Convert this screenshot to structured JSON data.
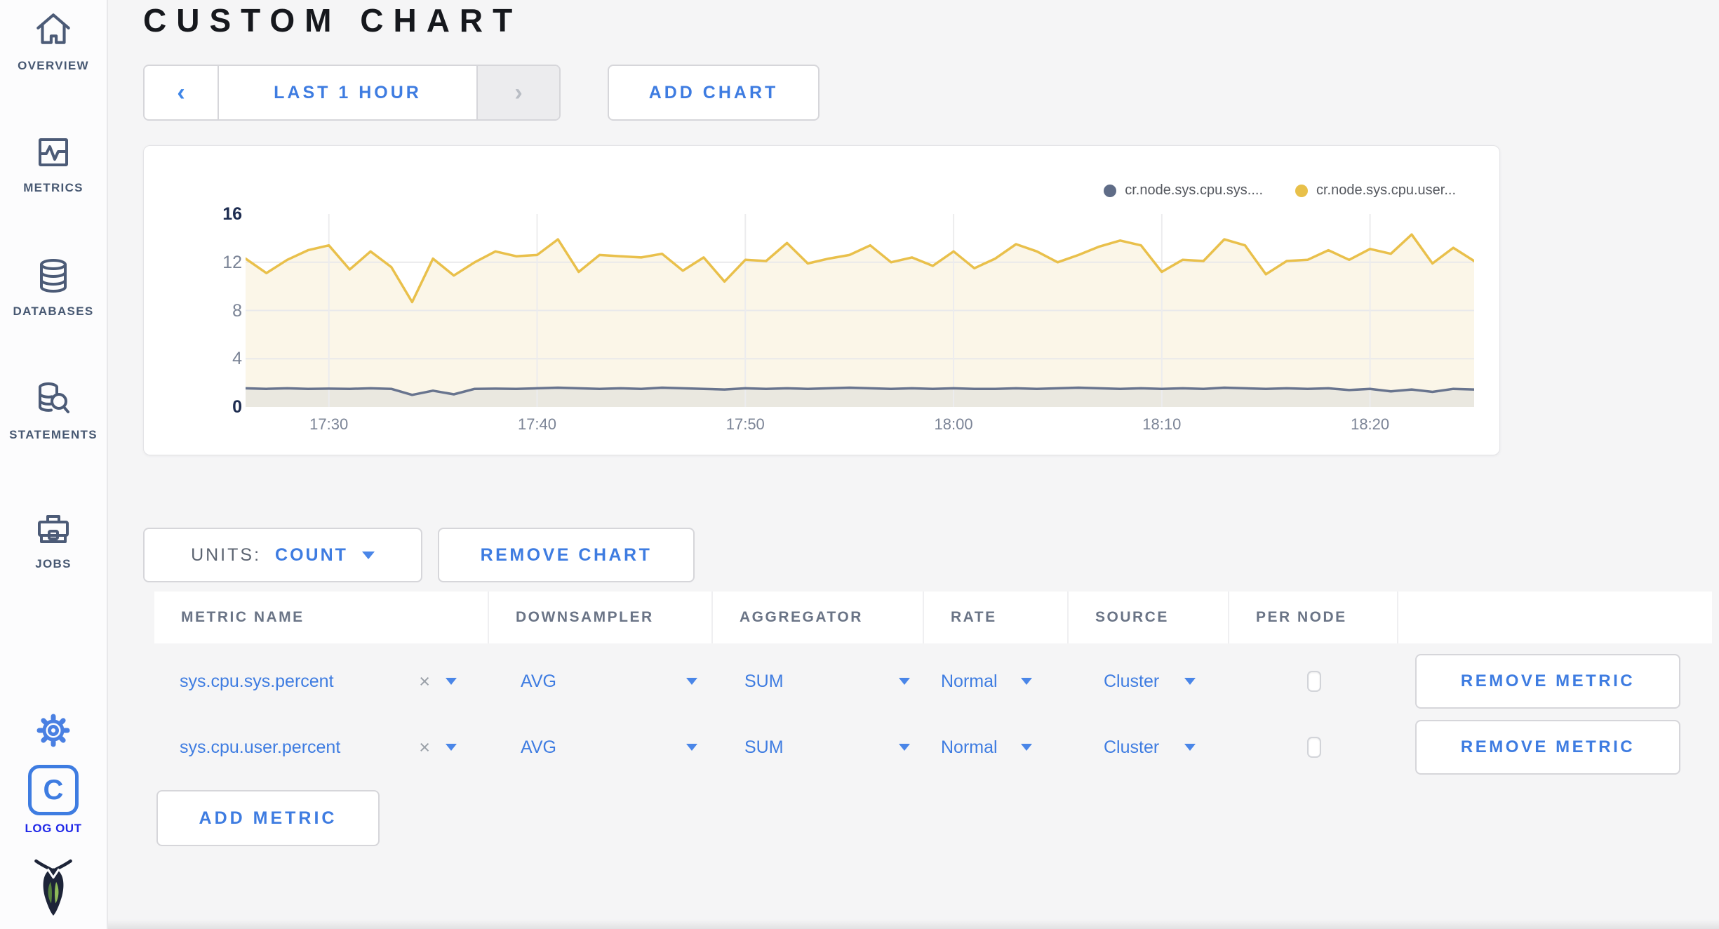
{
  "header": {
    "title": "CUSTOM CHART"
  },
  "sidebar": {
    "items": [
      {
        "label": "OVERVIEW",
        "icon": "home-icon"
      },
      {
        "label": "METRICS",
        "icon": "metrics-icon"
      },
      {
        "label": "DATABASES",
        "icon": "database-icon"
      },
      {
        "label": "STATEMENTS",
        "icon": "statements-icon"
      },
      {
        "label": "JOBS",
        "icon": "briefcase-icon"
      }
    ],
    "logout_initial": "C",
    "logout_label": "LOG OUT"
  },
  "toolbar": {
    "prev_arrow": "‹",
    "next_arrow": "›",
    "time_range_label": "LAST 1 HOUR",
    "add_chart_label": "ADD CHART"
  },
  "chart_controls": {
    "units_label": "UNITS:",
    "units_value": "COUNT",
    "remove_chart_label": "REMOVE CHART"
  },
  "legend": [
    {
      "label": "cr.node.sys.cpu.sys....",
      "color": "#5f6c87"
    },
    {
      "label": "cr.node.sys.cpu.user...",
      "color": "#e8c04a"
    }
  ],
  "chart_data": {
    "type": "line",
    "title": "",
    "xlabel": "",
    "ylabel": "",
    "ylim": [
      0,
      16
    ],
    "y_ticks": [
      16,
      12,
      8,
      4,
      0
    ],
    "y_gridlines": [
      12,
      8,
      4
    ],
    "x_domain_minutes": [
      0,
      59
    ],
    "x_ticks": [
      {
        "minute": 4,
        "label": "17:30"
      },
      {
        "minute": 14,
        "label": "17:40"
      },
      {
        "minute": 24,
        "label": "17:50"
      },
      {
        "minute": 34,
        "label": "18:00"
      },
      {
        "minute": 44,
        "label": "18:10"
      },
      {
        "minute": 54,
        "label": "18:20"
      }
    ],
    "grid": true,
    "legend_position": "top-right",
    "series": [
      {
        "name": "cr.node.sys.cpu.user...",
        "color": "#e9c04b",
        "area_fill": "#fbf6e8",
        "values": [
          12.3,
          11.1,
          12.2,
          13.0,
          13.4,
          11.4,
          12.9,
          11.6,
          8.7,
          12.3,
          10.9,
          12.0,
          12.9,
          12.5,
          12.6,
          13.9,
          11.2,
          12.6,
          12.5,
          12.4,
          12.7,
          11.3,
          12.4,
          10.4,
          12.2,
          12.1,
          13.6,
          11.9,
          12.3,
          12.6,
          13.4,
          12.0,
          12.4,
          11.7,
          12.9,
          11.5,
          12.3,
          13.5,
          12.9,
          12.0,
          12.6,
          13.3,
          13.8,
          13.4,
          11.2,
          12.2,
          12.1,
          13.9,
          13.4,
          11.0,
          12.1,
          12.2,
          13.0,
          12.2,
          13.1,
          12.7,
          14.3,
          11.9,
          13.2,
          12.1
        ]
      },
      {
        "name": "cr.node.sys.cpu.sys....",
        "color": "#68748e",
        "area_fill": "#eae8e0",
        "values": [
          1.55,
          1.5,
          1.55,
          1.5,
          1.52,
          1.5,
          1.55,
          1.5,
          1.0,
          1.35,
          1.05,
          1.5,
          1.52,
          1.5,
          1.55,
          1.6,
          1.55,
          1.5,
          1.55,
          1.5,
          1.6,
          1.55,
          1.5,
          1.45,
          1.55,
          1.5,
          1.55,
          1.5,
          1.55,
          1.6,
          1.55,
          1.5,
          1.55,
          1.5,
          1.55,
          1.5,
          1.5,
          1.55,
          1.5,
          1.55,
          1.6,
          1.55,
          1.5,
          1.55,
          1.5,
          1.55,
          1.5,
          1.6,
          1.55,
          1.5,
          1.55,
          1.5,
          1.55,
          1.4,
          1.5,
          1.3,
          1.45,
          1.25,
          1.5,
          1.45
        ]
      }
    ]
  },
  "table": {
    "headers": [
      "METRIC NAME",
      "DOWNSAMPLER",
      "AGGREGATOR",
      "RATE",
      "SOURCE",
      "PER NODE",
      ""
    ],
    "rows": [
      {
        "metric": "sys.cpu.sys.percent",
        "clear": "×",
        "downsampler": "AVG",
        "aggregator": "SUM",
        "rate": "Normal",
        "source": "Cluster",
        "per_node_checked": false,
        "action": "REMOVE METRIC"
      },
      {
        "metric": "sys.cpu.user.percent",
        "clear": "×",
        "downsampler": "AVG",
        "aggregator": "SUM",
        "rate": "Normal",
        "source": "Cluster",
        "per_node_checked": false,
        "action": "REMOVE METRIC"
      }
    ],
    "add_metric_label": "ADD METRIC"
  },
  "colors": {
    "accent_blue": "#3e7ce1",
    "logout_blue": "#2129e8",
    "sidebar_text": "#475872",
    "series_user_yellow": "#e9c04b",
    "series_sys_gray": "#68748e"
  }
}
